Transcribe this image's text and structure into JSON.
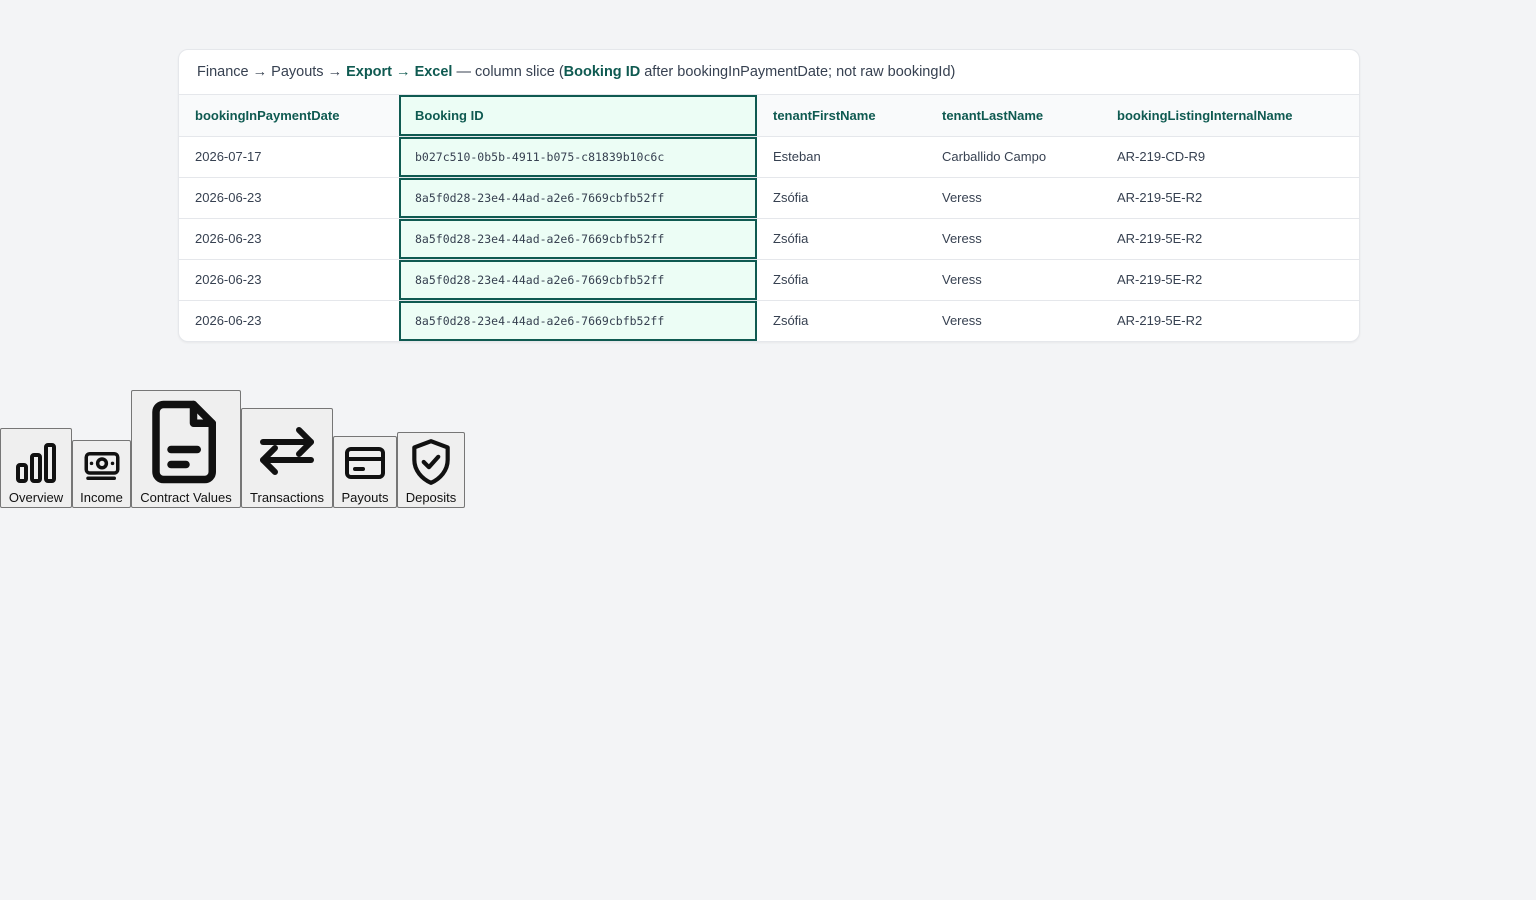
{
  "caption": {
    "part1": "Finance → Payouts → ",
    "part2": "Export → Excel",
    "part3": " — column slice (",
    "part4": "Booking ID",
    "part5": " after bookingInPaymentDate; not raw bookingId)"
  },
  "table": {
    "headers": [
      "bookingInPaymentDate",
      "Booking ID",
      "tenantFirstName",
      "tenantLastName",
      "bookingListingInternalName"
    ],
    "rows": [
      [
        "2026-07-17",
        "b027c510-0b5b-4911-b075-c81839b10c6c",
        "Esteban",
        "Carballido Campo",
        "AR-219-CD-R9"
      ],
      [
        "2026-06-23",
        "8a5f0d28-23e4-44ad-a2e6-7669cbfb52ff",
        "Zsófia",
        "Veress",
        "AR-219-5E-R2"
      ],
      [
        "2026-06-23",
        "8a5f0d28-23e4-44ad-a2e6-7669cbfb52ff",
        "Zsófia",
        "Veress",
        "AR-219-5E-R2"
      ],
      [
        "2026-06-23",
        "8a5f0d28-23e4-44ad-a2e6-7669cbfb52ff",
        "Zsófia",
        "Veress",
        "AR-219-5E-R2"
      ],
      [
        "2026-06-23",
        "8a5f0d28-23e4-44ad-a2e6-7669cbfb52ff",
        "Zsófia",
        "Veress",
        "AR-219-5E-R2"
      ]
    ]
  },
  "nav": {
    "items": [
      {
        "label": "Overview",
        "icon": "bar-chart-icon"
      },
      {
        "label": "Income",
        "icon": "banknote-icon"
      },
      {
        "label": "Contract Values",
        "icon": "document-icon"
      },
      {
        "label": "Transactions",
        "icon": "arrows-swap-icon"
      },
      {
        "label": "Payouts",
        "icon": "credit-card-icon"
      },
      {
        "label": "Deposits",
        "icon": "shield-check-icon"
      }
    ]
  },
  "colors": {
    "accent": "#0f5a51",
    "highlight_bg": "#ecfdf5",
    "page_bg": "#f3f4f6"
  }
}
